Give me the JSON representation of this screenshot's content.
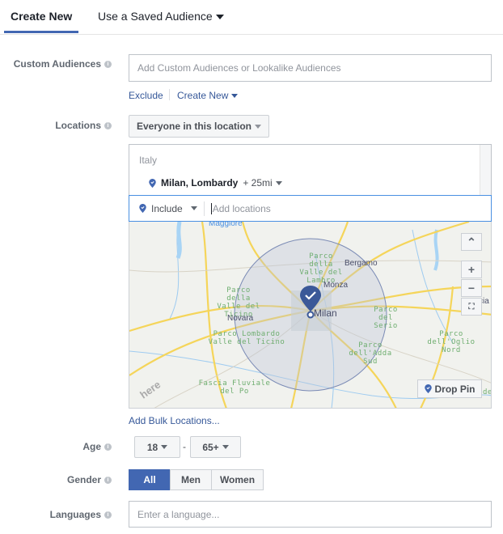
{
  "tabs": {
    "create_new": "Create New",
    "saved_audience": "Use a Saved Audience"
  },
  "custom_audiences": {
    "label": "Custom Audiences",
    "placeholder": "Add Custom Audiences or Lookalike Audiences",
    "exclude": "Exclude",
    "create_new": "Create New"
  },
  "locations": {
    "label": "Locations",
    "dropdown": "Everyone in this location",
    "country": "Italy",
    "selected": "Milan, Lombardy",
    "radius": "+ 25mi",
    "include": "Include",
    "placeholder": "Add locations",
    "bulk": "Add Bulk Locations..."
  },
  "map": {
    "labels": {
      "maggiore": "Maggiore",
      "lambro": "Parco della Valle del Lambro",
      "bergamo": "Bergamo",
      "monza": "Monza",
      "ticino_valle": "Parco della Valle del Ticino",
      "novara": "Novara",
      "milan": "Milan",
      "serio": "Parco del Serio",
      "lombardo": "Parco Lombardo Valle del Ticino",
      "adda": "Parco dell'Adda Sud",
      "oglio": "Parco dell'Oglio Nord",
      "po": "Fascia Fluviale del Po",
      "edge": "cia",
      "edge2": "de"
    },
    "watermark": "here",
    "drop_pin": "Drop Pin",
    "zoom_in": "+",
    "zoom_out": "−",
    "accent": "#4267b2"
  },
  "age": {
    "label": "Age",
    "min": "18",
    "separator": "-",
    "max": "65+"
  },
  "gender": {
    "label": "Gender",
    "options": [
      "All",
      "Men",
      "Women"
    ],
    "selected": "All"
  },
  "languages": {
    "label": "Languages",
    "placeholder": "Enter a language..."
  }
}
